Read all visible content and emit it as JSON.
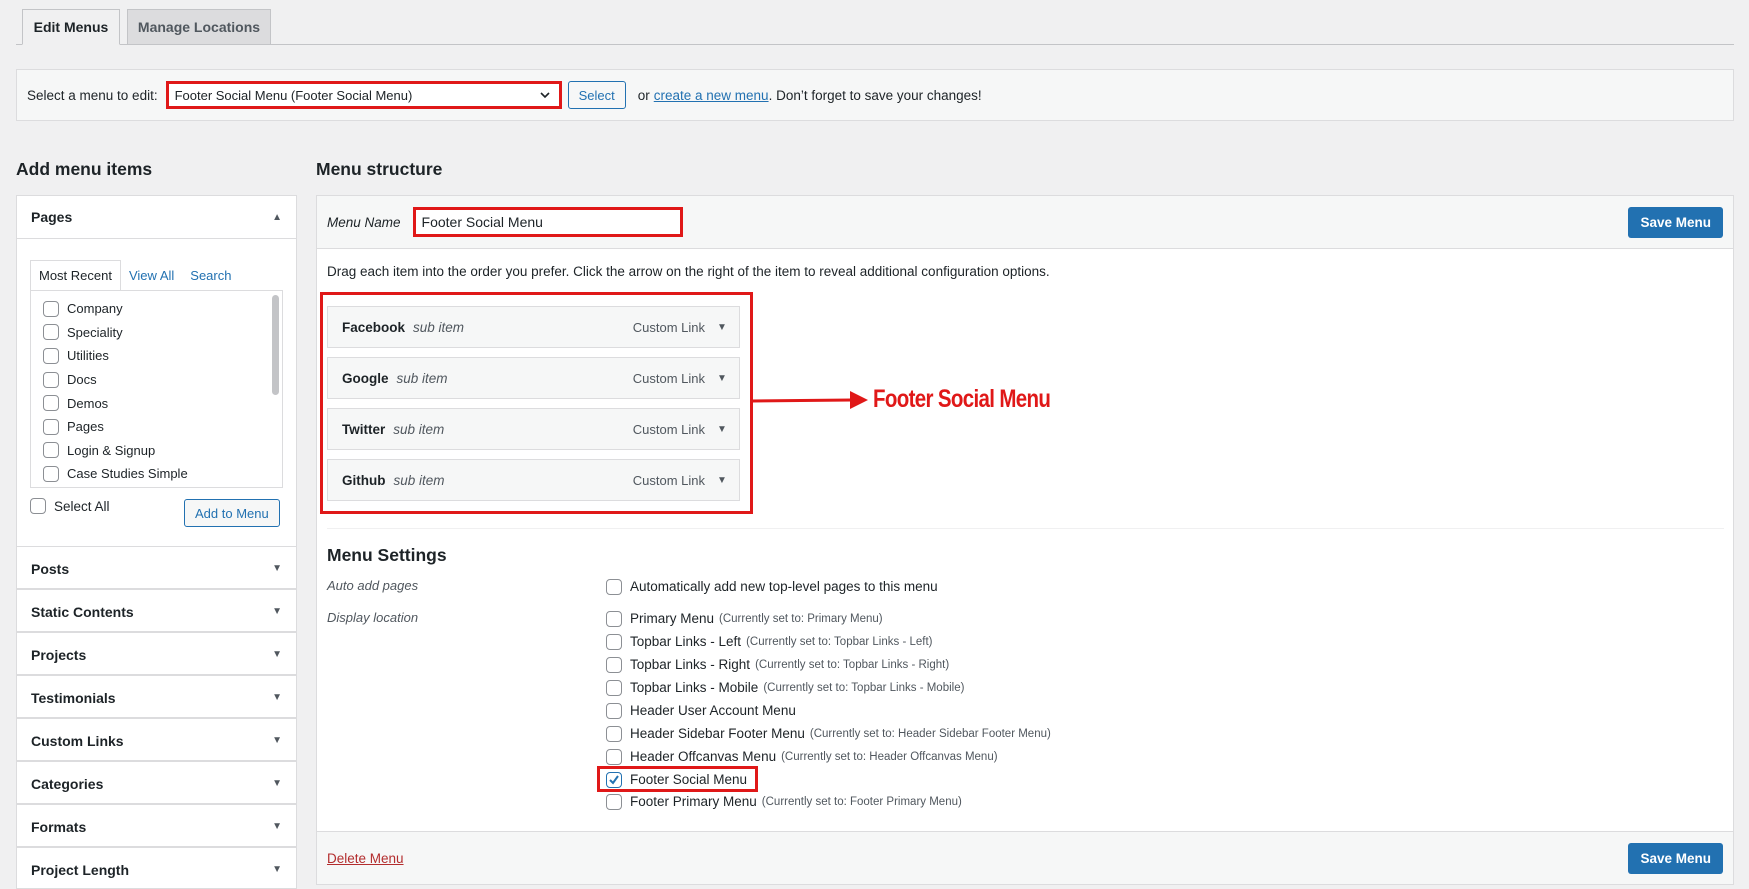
{
  "tabs": {
    "edit": "Edit Menus",
    "manage": "Manage Locations"
  },
  "select_bar": {
    "label": "Select a menu to edit:",
    "selected": "Footer Social Menu (Footer Social Menu)",
    "select_button": "Select",
    "or_text": "or",
    "create_link": "create a new menu",
    "reminder": ". Don’t forget to save your changes!"
  },
  "left": {
    "heading": "Add menu items",
    "pages": {
      "title": "Pages",
      "tabs": [
        "Most Recent",
        "View All",
        "Search"
      ],
      "items": [
        "Company",
        "Speciality",
        "Utilities",
        "Docs",
        "Demos",
        "Pages",
        "Login & Signup",
        "Case Studies Simple"
      ],
      "select_all": "Select All",
      "add_button": "Add to Menu"
    },
    "sections": [
      "Posts",
      "Static Contents",
      "Projects",
      "Testimonials",
      "Custom Links",
      "Categories",
      "Formats",
      "Project Length"
    ]
  },
  "right": {
    "heading": "Menu structure",
    "menu_name_label": "Menu Name",
    "menu_name_value": "Footer Social Menu",
    "save_button": "Save Menu",
    "instructions": "Drag each item into the order you prefer. Click the arrow on the right of the item to reveal additional configuration options.",
    "items": [
      {
        "title": "Facebook",
        "sub": "sub item",
        "type": "Custom Link"
      },
      {
        "title": "Google",
        "sub": "sub item",
        "type": "Custom Link"
      },
      {
        "title": "Twitter",
        "sub": "sub item",
        "type": "Custom Link"
      },
      {
        "title": "Github",
        "sub": "sub item",
        "type": "Custom Link"
      }
    ],
    "annotation": "Footer Social Menu",
    "settings": {
      "heading": "Menu Settings",
      "auto_add_label": "Auto add pages",
      "auto_add_text": "Automatically add new top-level pages to this menu",
      "display_label": "Display location",
      "locations": [
        {
          "name": "Primary Menu",
          "note": "(Currently set to: Primary Menu)",
          "checked": false
        },
        {
          "name": "Topbar Links - Left",
          "note": "(Currently set to: Topbar Links - Left)",
          "checked": false
        },
        {
          "name": "Topbar Links - Right",
          "note": "(Currently set to: Topbar Links - Right)",
          "checked": false
        },
        {
          "name": "Topbar Links - Mobile",
          "note": "(Currently set to: Topbar Links - Mobile)",
          "checked": false
        },
        {
          "name": "Header User Account Menu",
          "note": "",
          "checked": false
        },
        {
          "name": "Header Sidebar Footer Menu",
          "note": "(Currently set to: Header Sidebar Footer Menu)",
          "checked": false
        },
        {
          "name": "Header Offcanvas Menu",
          "note": "(Currently set to: Header Offcanvas Menu)",
          "checked": false
        },
        {
          "name": "Footer Social Menu",
          "note": "",
          "checked": true
        },
        {
          "name": "Footer Primary Menu",
          "note": "(Currently set to: Footer Primary Menu)",
          "checked": false
        }
      ]
    },
    "delete_link": "Delete Menu"
  },
  "colors": {
    "accent": "#2271b1",
    "annotation_red": "#e01818",
    "delete_red": "#b32d2e"
  }
}
